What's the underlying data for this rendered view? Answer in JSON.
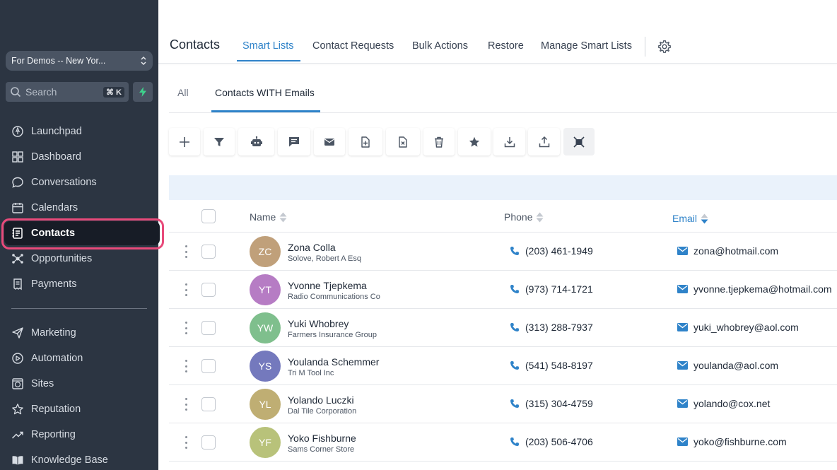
{
  "sidebar": {
    "account": "For Demos -- New Yor...",
    "search_placeholder": "Search",
    "search_shortcut": "⌘ K",
    "items": [
      {
        "label": "Launchpad",
        "icon": "rocket-icon"
      },
      {
        "label": "Dashboard",
        "icon": "grid-icon"
      },
      {
        "label": "Conversations",
        "icon": "chat-bubble-icon"
      },
      {
        "label": "Calendars",
        "icon": "calendar-icon"
      },
      {
        "label": "Contacts",
        "icon": "contact-book-icon"
      },
      {
        "label": "Opportunities",
        "icon": "network-icon"
      },
      {
        "label": "Payments",
        "icon": "receipt-icon"
      },
      {
        "label": "Marketing",
        "icon": "send-icon"
      },
      {
        "label": "Automation",
        "icon": "automation-icon"
      },
      {
        "label": "Sites",
        "icon": "globe-icon"
      },
      {
        "label": "Reputation",
        "icon": "star-icon"
      },
      {
        "label": "Reporting",
        "icon": "trend-up-icon"
      },
      {
        "label": "Knowledge Base",
        "icon": "book-open-icon"
      }
    ]
  },
  "topnav": {
    "title": "Contacts",
    "tabs": [
      "Smart Lists",
      "Contact Requests",
      "Bulk Actions",
      "Restore",
      "Manage Smart Lists"
    ]
  },
  "subtabs": [
    "All",
    "Contacts WITH Emails"
  ],
  "table": {
    "headers": {
      "name": "Name",
      "phone": "Phone",
      "email": "Email"
    },
    "rows": [
      {
        "initials": "ZC",
        "name": "Zona Colla",
        "company": "Solove, Robert A Esq",
        "phone": "(203) 461-1949",
        "email": "zona@hotmail.com",
        "color": "#c0a07a"
      },
      {
        "initials": "YT",
        "name": "Yvonne Tjepkema",
        "company": "Radio Communications Co",
        "phone": "(973) 714-1721",
        "email": "yvonne.tjepkema@hotmail.com",
        "color": "#b67cc4"
      },
      {
        "initials": "YW",
        "name": "Yuki Whobrey",
        "company": "Farmers Insurance Group",
        "phone": "(313) 288-7937",
        "email": "yuki_whobrey@aol.com",
        "color": "#7fbf8d"
      },
      {
        "initials": "YS",
        "name": "Youlanda Schemmer",
        "company": "Tri M Tool Inc",
        "phone": "(541) 548-8197",
        "email": "youlanda@aol.com",
        "color": "#7479bd"
      },
      {
        "initials": "YL",
        "name": "Yolando Luczki",
        "company": "Dal Tile Corporation",
        "phone": "(315) 304-4759",
        "email": "yolando@cox.net",
        "color": "#bfae73"
      },
      {
        "initials": "YF",
        "name": "Yoko Fishburne",
        "company": "Sams Corner Store",
        "phone": "(203) 506-4706",
        "email": "yoko@fishburne.com",
        "color": "#b8c27a"
      }
    ]
  },
  "colors": {
    "accent": "#2f83c9",
    "sidebar": "#2c3542",
    "highlight": "#e84a7a"
  }
}
